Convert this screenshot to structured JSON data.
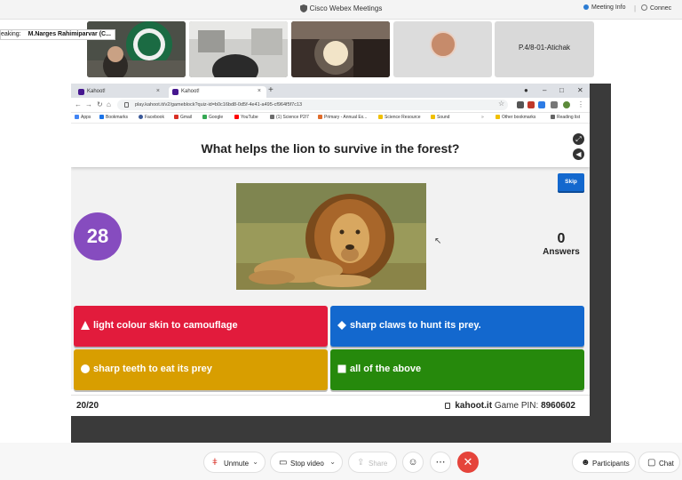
{
  "app": {
    "title": "Cisco Webex Meetings",
    "meeting_info": "Meeting Info",
    "connection": "Connec"
  },
  "speaking": {
    "prefix": "eaking:",
    "name": "M.Narges Rahimiparvar (C..."
  },
  "participants_strip": {
    "tile5_name": "P.4/8-01-Atichak"
  },
  "browser": {
    "tabs": [
      {
        "label": "Kahoot!"
      },
      {
        "label": "Kahoot!"
      }
    ],
    "url": "play.kahoot.it/v2/gameblock?quiz-id=b0c16bd8-0d5f-4e41-a495-cf964f5f7c13",
    "bookmarks": [
      {
        "label": "Apps",
        "color": "#4285f4"
      },
      {
        "label": "Bookmarks",
        "color": "#1a73e8"
      },
      {
        "label": "Facebook",
        "color": "#3b5998"
      },
      {
        "label": "Gmail",
        "color": "#d93025"
      },
      {
        "label": "Google",
        "color": "#34a853"
      },
      {
        "label": "YouTube",
        "color": "#ff0000"
      },
      {
        "label": "(1) Science P2/7",
        "color": "#6d6d6d"
      },
      {
        "label": "Primary - Annual Ex...",
        "color": "#e06c2b"
      },
      {
        "label": "Science Resource",
        "color": "#f0c000"
      },
      {
        "label": "Sound",
        "color": "#f0c000"
      },
      {
        "label": "Other bookmarks",
        "color": "#f0c000"
      },
      {
        "label": "Reading list",
        "color": "#666666"
      }
    ]
  },
  "kahoot": {
    "question": "What helps the lion to survive in the forest?",
    "timer": "28",
    "skip_label": "Skip",
    "answers_count": "0",
    "answers_label": "Answers",
    "answers": [
      {
        "label": "light colour skin to camouflage",
        "shape": "triangle",
        "color": "#e21b3c"
      },
      {
        "label": "sharp claws to hunt its prey.",
        "shape": "diamond",
        "color": "#1368ce"
      },
      {
        "label": "sharp teeth to eat its prey",
        "shape": "circle",
        "color": "#d89e00"
      },
      {
        "label": "all of the above",
        "shape": "square",
        "color": "#26890c"
      }
    ],
    "progress": "20/20",
    "site": "kahoot.it",
    "game_pin_label": "Game PIN:",
    "game_pin": "8960602"
  },
  "controls": {
    "unmute": "Unmute",
    "stop_video": "Stop video",
    "share": "Share",
    "participants": "Participants",
    "chat": "Chat"
  }
}
